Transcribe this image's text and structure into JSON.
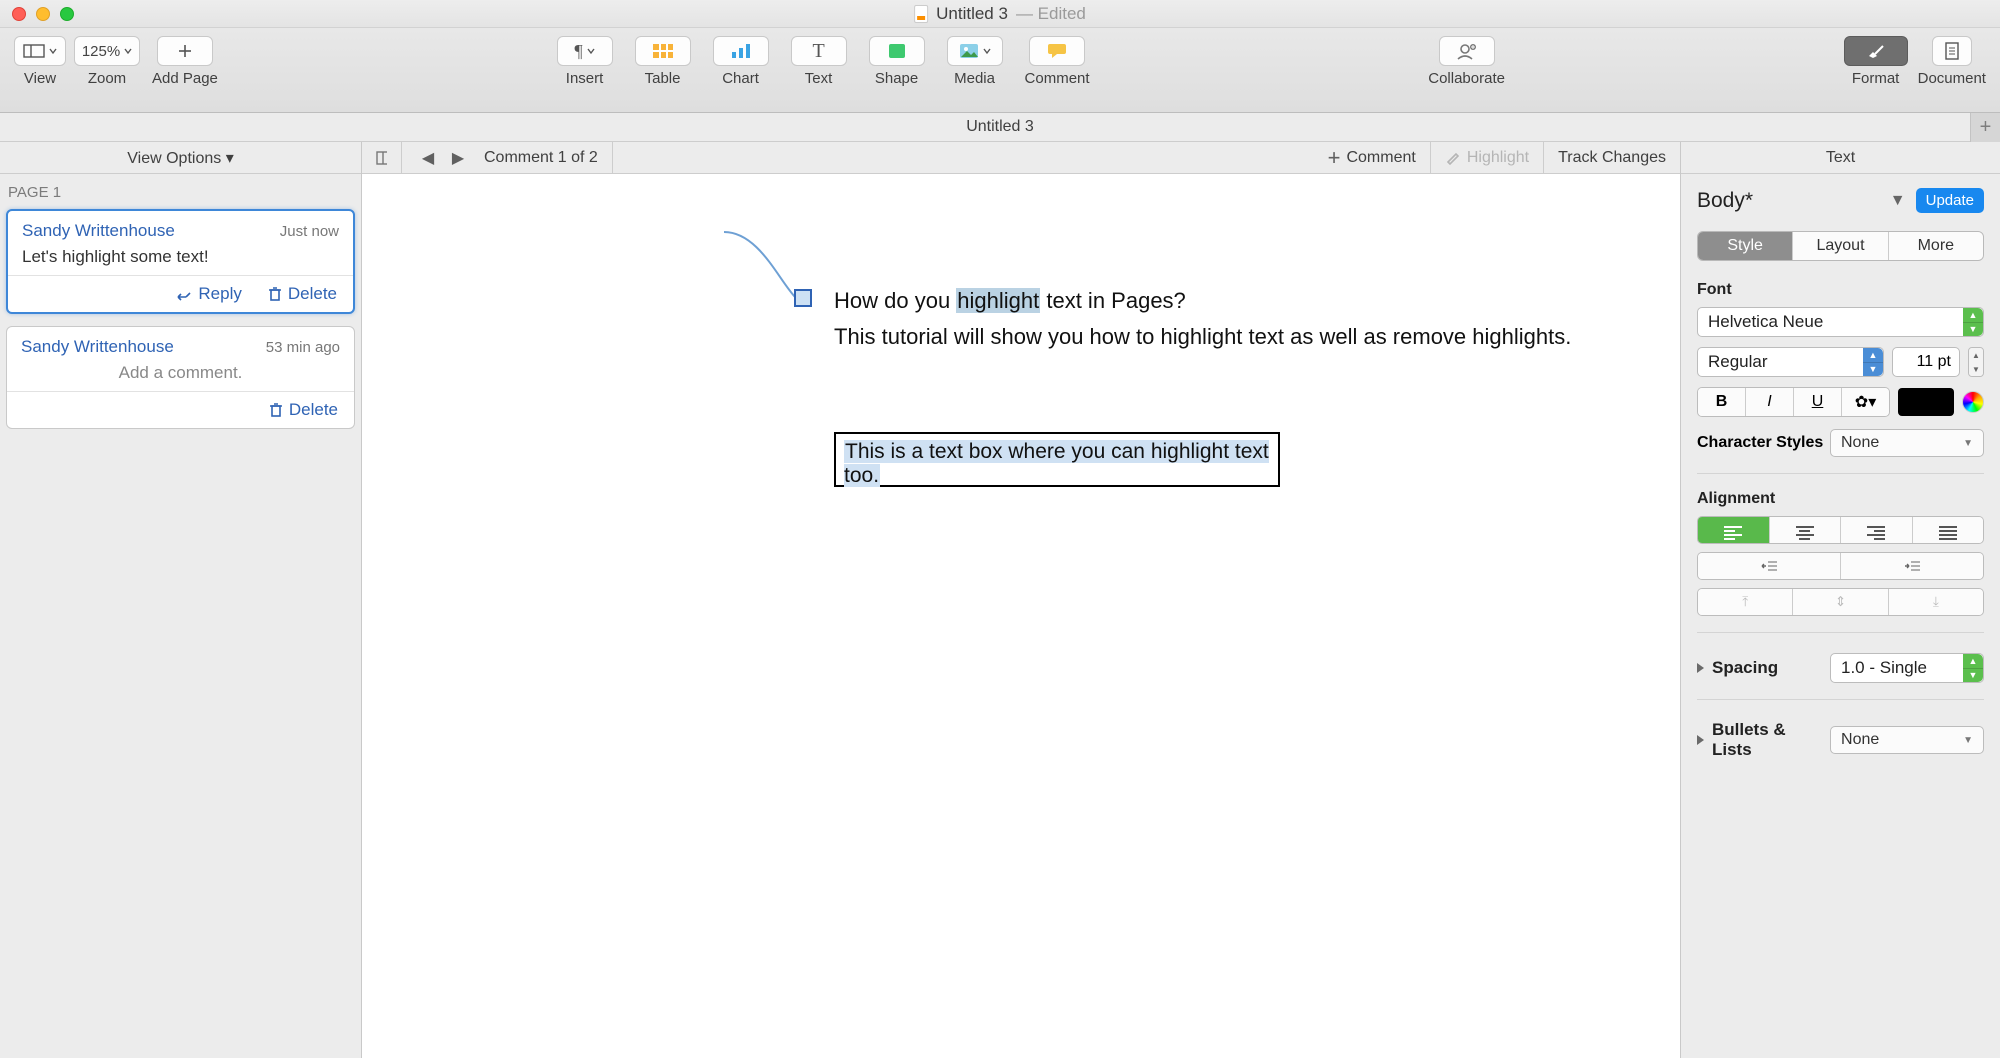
{
  "window": {
    "title": "Untitled 3",
    "status": "Edited"
  },
  "toolbar": {
    "view": "View",
    "zoom_value": "125%",
    "zoom": "Zoom",
    "add_page": "Add Page",
    "insert": "Insert",
    "table": "Table",
    "chart": "Chart",
    "text": "Text",
    "shape": "Shape",
    "media": "Media",
    "comment": "Comment",
    "collaborate": "Collaborate",
    "format": "Format",
    "document": "Document"
  },
  "doc_tabs": {
    "title": "Untitled 3"
  },
  "comments_pane": {
    "view_options": "View Options ▾",
    "page_label": "PAGE 1",
    "reply": "Reply",
    "delete": "Delete",
    "add_placeholder": "Add a comment.",
    "items": [
      {
        "author": "Sandy Writtenhouse",
        "time": "Just now",
        "body": "Let's highlight some text!"
      },
      {
        "author": "Sandy Writtenhouse",
        "time": "53 min ago",
        "body": ""
      }
    ]
  },
  "comment_bar": {
    "counter": "Comment 1 of 2",
    "add_comment": "Comment",
    "highlight": "Highlight",
    "track_changes": "Track Changes"
  },
  "document": {
    "line1_pre": "How do you ",
    "line1_hl": "highlight",
    "line1_post": " text in Pages?",
    "line2": "This tutorial will show you how to highlight text as well as remove highlights.",
    "textbox": "This is a text box where you can highlight text too."
  },
  "inspector": {
    "title": "Text",
    "paragraph_style": "Body*",
    "update": "Update",
    "tabs": {
      "style": "Style",
      "layout": "Layout",
      "more": "More"
    },
    "font_label": "Font",
    "font_family": "Helvetica Neue",
    "font_style": "Regular",
    "font_size": "11 pt",
    "char_styles_label": "Character Styles",
    "char_styles_value": "None",
    "alignment_label": "Alignment",
    "spacing_label": "Spacing",
    "spacing_value": "1.0 - Single",
    "bullets_label": "Bullets & Lists",
    "bullets_value": "None"
  }
}
